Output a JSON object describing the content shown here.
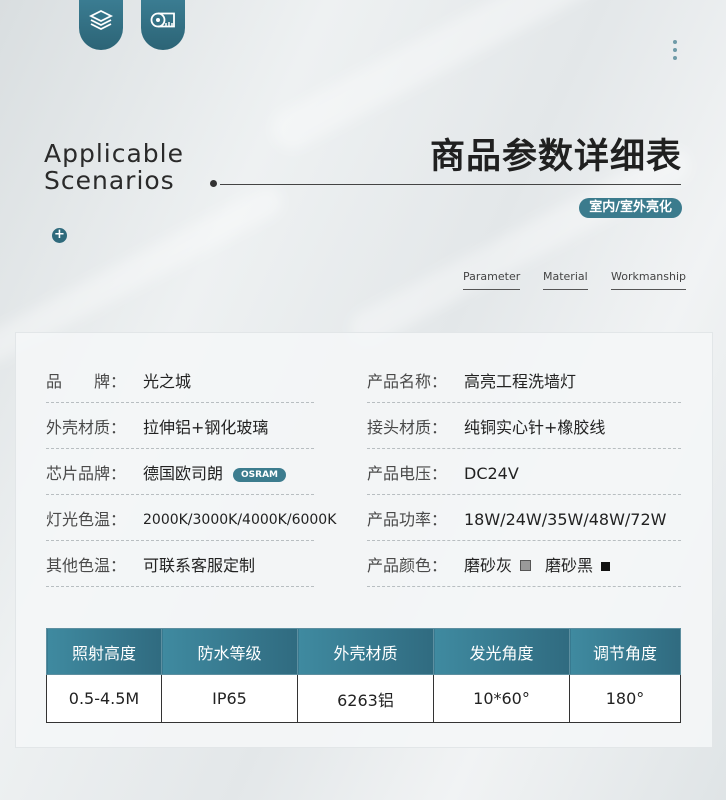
{
  "header": {
    "app_title_line1": "Applicable",
    "app_title_line2": "Scenarios",
    "main_title": "商品参数详细表",
    "badge": "室内/室外亮化",
    "plus_symbol": "+"
  },
  "icons": {
    "tab1": "layers-icon",
    "tab2": "tape-measure-icon",
    "menu": "more-vertical-icon",
    "accent_color": "#3b7b8d"
  },
  "subnav": [
    "Parameter",
    "Material",
    "Workmanship"
  ],
  "specs_left": [
    {
      "label": "品　　牌：",
      "value": "光之城"
    },
    {
      "label": "外壳材质：",
      "value": "拉伸铝+钢化玻璃"
    },
    {
      "label": "芯片品牌：",
      "value": "德国欧司朗",
      "badge": "OSRAM"
    },
    {
      "label": "灯光色温：",
      "value": "2000K/3000K/4000K/6000K"
    },
    {
      "label": "其他色温：",
      "value": "可联系客服定制"
    }
  ],
  "specs_right": [
    {
      "label": "产品名称：",
      "value": "高亮工程洗墙灯"
    },
    {
      "label": "接头材质：",
      "value": "纯铜实心针+橡胶线"
    },
    {
      "label": "产品电压：",
      "value": "DC24V"
    },
    {
      "label": "产品功率：",
      "value": "18W/24W/35W/48W/72W"
    },
    {
      "label": "产品颜色：",
      "value": "",
      "colors": [
        {
          "name": "磨砂灰",
          "swatch": "#9a9a9a"
        },
        {
          "name": "磨砂黑",
          "swatch": "#111111"
        }
      ]
    }
  ],
  "table": {
    "headers": [
      "照射高度",
      "防水等级",
      "外壳材质",
      "发光角度",
      "调节角度"
    ],
    "row": [
      "0.5-4.5M",
      "IP65",
      "6263铝",
      "10*60°",
      "180°"
    ]
  }
}
